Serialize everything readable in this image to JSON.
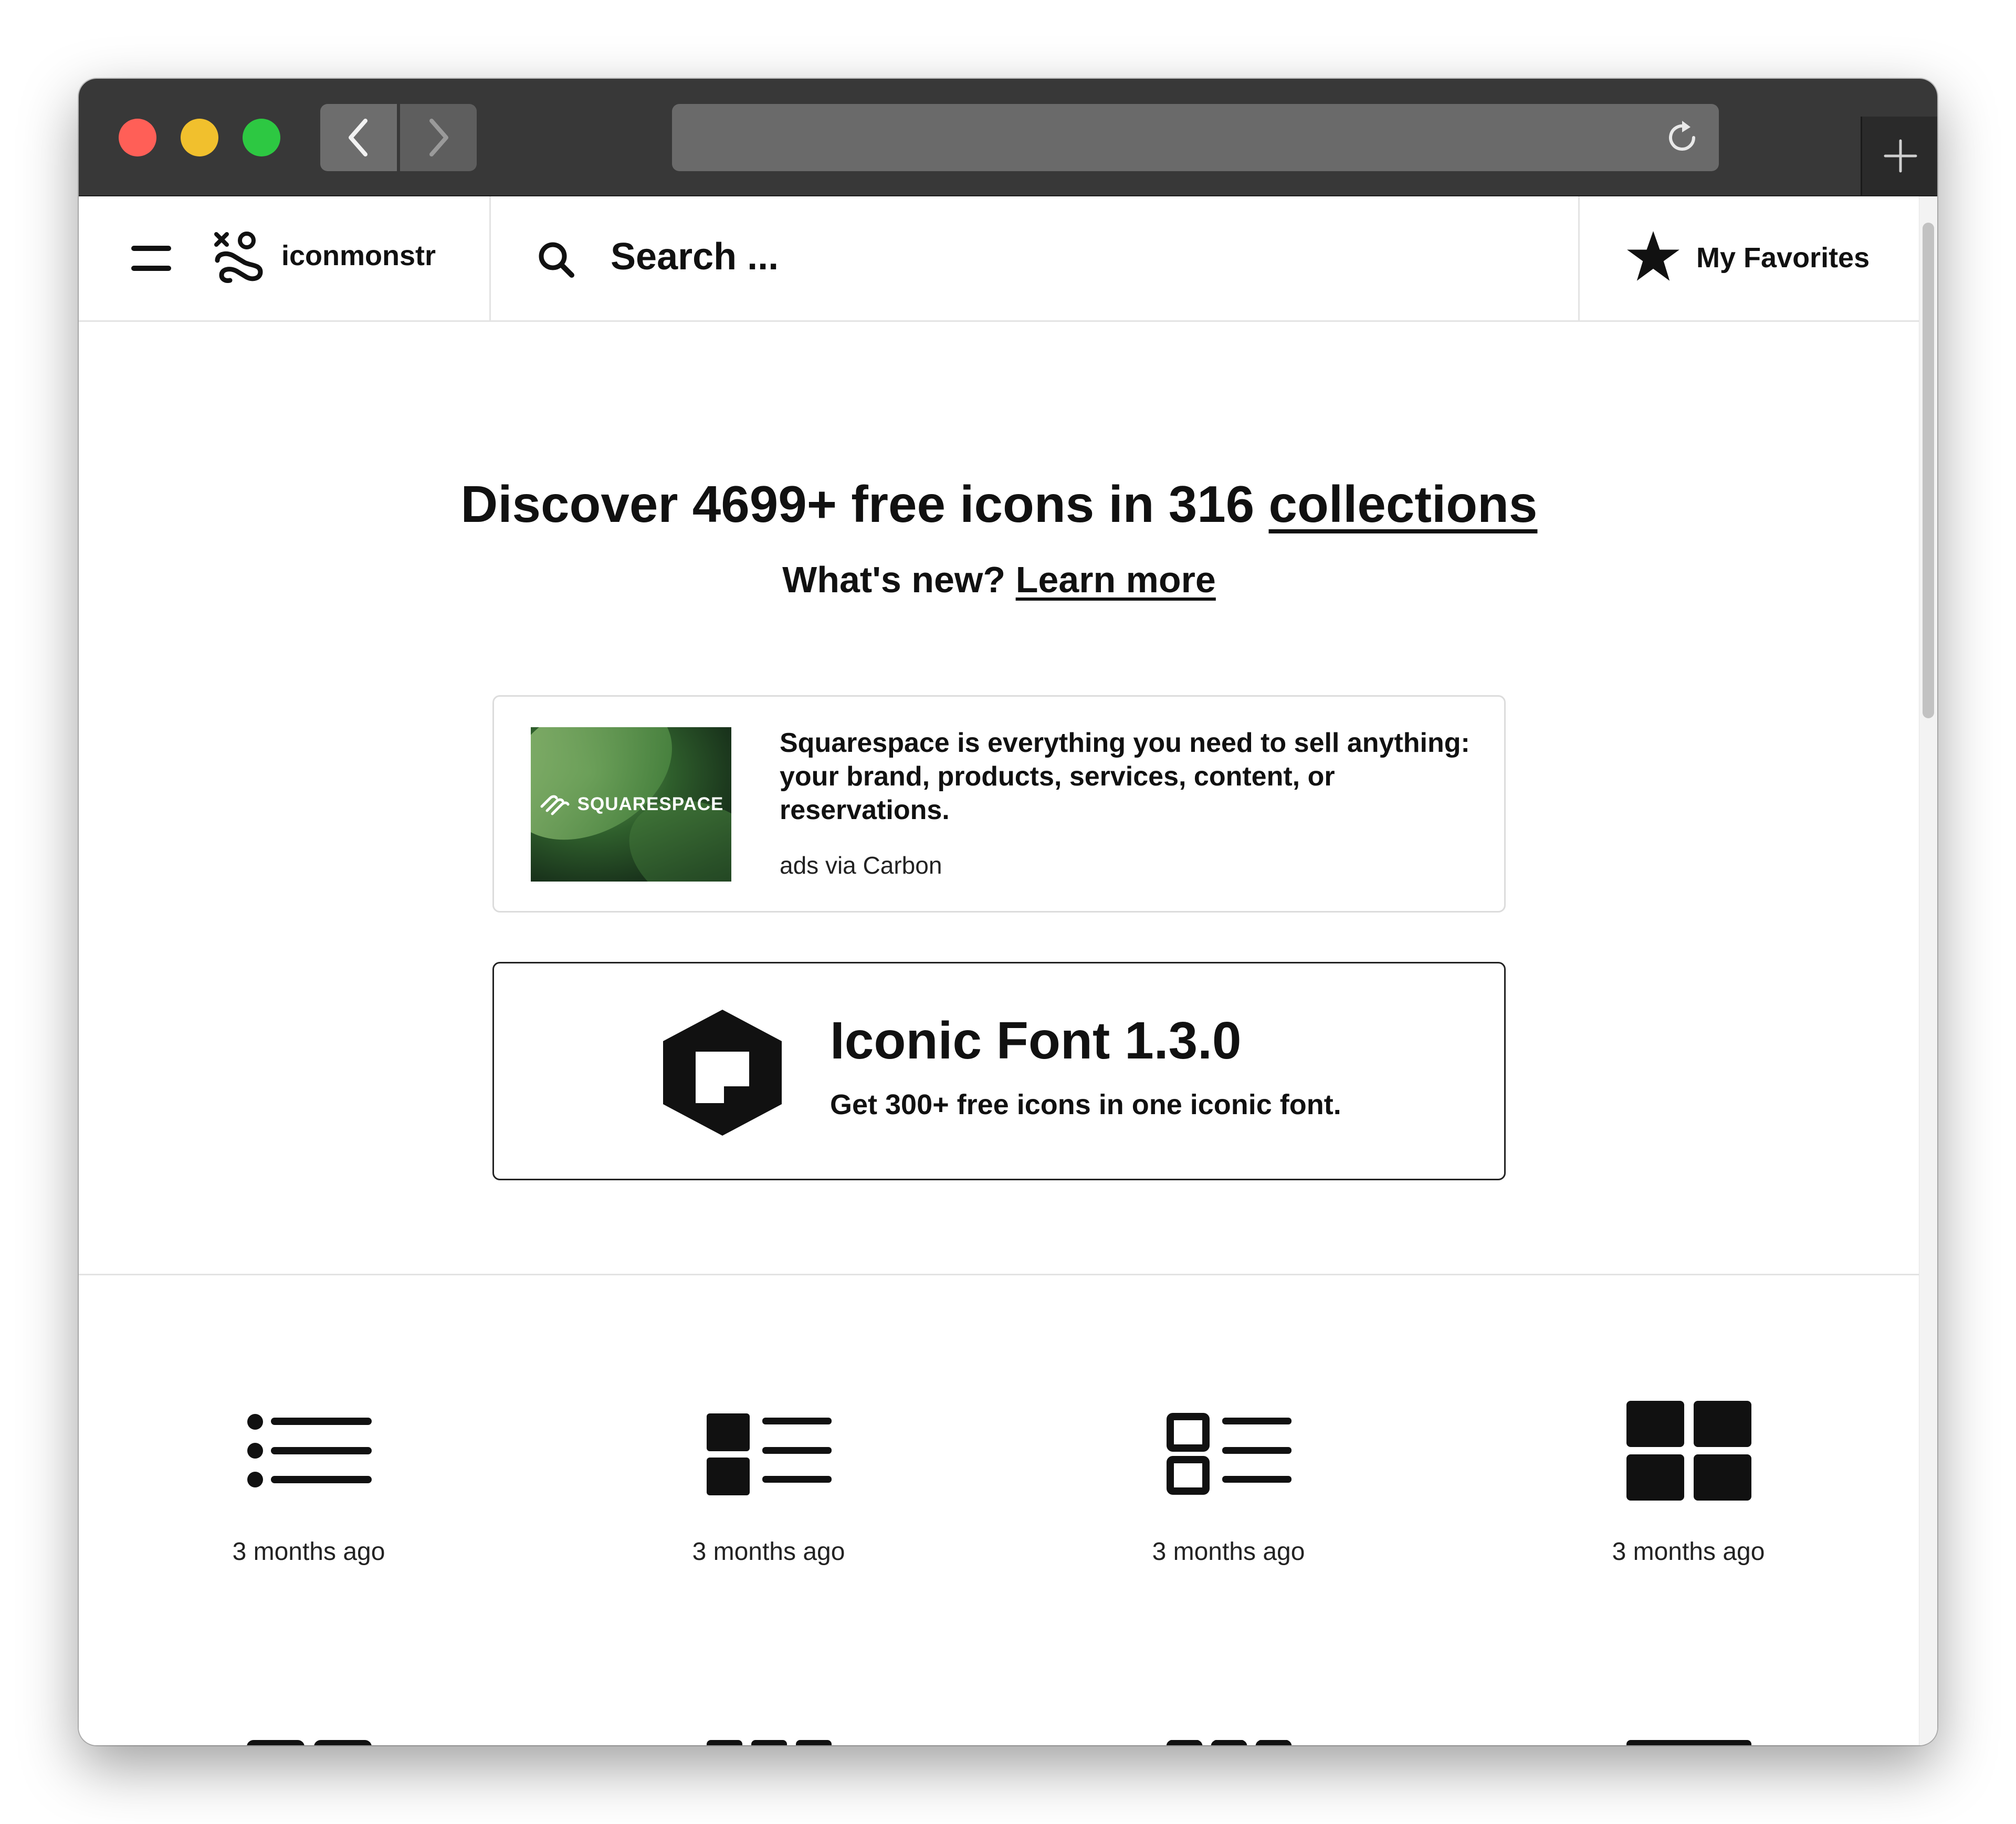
{
  "browser": {
    "url": "",
    "controls": [
      "close",
      "minimize",
      "maximize",
      "back",
      "forward",
      "reload",
      "new-tab"
    ]
  },
  "header": {
    "brand_name": "iconmonstr",
    "search_placeholder": "Search ...",
    "favorites_label": "My Favorites"
  },
  "hero": {
    "title_prefix": "Discover 4699+ free icons in 316",
    "title_link": "collections",
    "subtitle_prefix": "What's new?",
    "subtitle_link": "Learn more"
  },
  "ad": {
    "image_text": "SQUARESPACE",
    "text": "Squarespace is everything you need to sell anything: your brand, products, services, content, or reservations.",
    "via": "ads via Carbon"
  },
  "promo": {
    "title": "Iconic Font 1.3.0",
    "subtitle": "Get 300+ free icons in one iconic font."
  },
  "icons": [
    {
      "icon": "bullet-list-icon",
      "time": "3 months ago"
    },
    {
      "icon": "block-list-icon",
      "time": "3 months ago"
    },
    {
      "icon": "outline-list-icon",
      "time": "3 months ago"
    },
    {
      "icon": "grid-2x2-filled-icon",
      "time": "3 months ago"
    },
    {
      "icon": "grid-2x2-outline-icon",
      "time": ""
    },
    {
      "icon": "grid-3x3-filled-icon",
      "time": ""
    },
    {
      "icon": "grid-3x3-outline-icon",
      "time": ""
    },
    {
      "icon": "banner-grid-icon",
      "time": ""
    }
  ]
}
